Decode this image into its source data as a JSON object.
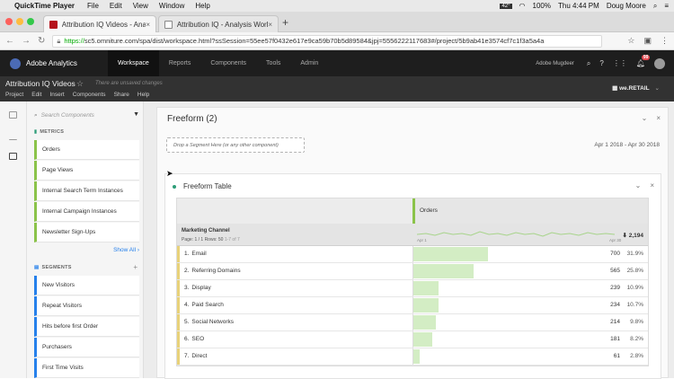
{
  "mac_menu": {
    "app": "QuickTime Player",
    "items": [
      "File",
      "Edit",
      "View",
      "Window",
      "Help"
    ],
    "battery": "100%",
    "clock": "Thu 4:44 PM",
    "user": "Doug Moore",
    "temp": "42°"
  },
  "browser": {
    "tabs": [
      {
        "label": "Attribution IQ Videos - Analysis",
        "active": true
      },
      {
        "label": "Attribution IQ - Analysis Works",
        "active": false
      }
    ],
    "url_prefix": "https://",
    "url": "sc5.omniture.com/spa/dist/workspace.html?ssSession=55ee57f0432e617e9ca59b70b5d89584&jpj=5556222117683#/project/5b9ab41e3574cf7c1f3a5a4a"
  },
  "analytics": {
    "brand": "Adobe Analytics",
    "nav": [
      "Workspace",
      "Reports",
      "Components",
      "Tools",
      "Admin"
    ],
    "active_nav": "Workspace",
    "company": "Adobe Mugdeer",
    "notification_count": "99"
  },
  "project": {
    "title": "Attribution IQ Videos",
    "unsaved": "There are unsaved changes",
    "menu": [
      "Project",
      "Edit",
      "Insert",
      "Components",
      "Share",
      "Help"
    ],
    "report_suite": "we.RETAIL"
  },
  "left_panel": {
    "search_placeholder": "Search Components",
    "metrics_header": "METRICS",
    "metrics": [
      "Orders",
      "Page Views",
      "Internal Search Term Instances",
      "Internal Campaign Instances",
      "Newsletter Sign-Ups"
    ],
    "show_all": "Show All",
    "segments_header": "SEGMENTS",
    "segments": [
      "New Visitors",
      "Repeat Visitors",
      "Hits before first Order",
      "Purchasers",
      "First Time Visits"
    ]
  },
  "freeform_panel": {
    "title": "Freeform (2)",
    "drop_zone": "Drop a Segment Here (or any other component)",
    "date_range": "Apr 1 2018 - Apr 30 2018"
  },
  "table": {
    "title": "Freeform Table",
    "metric": "Orders",
    "dimension": "Marketing Channel",
    "page_info": "Page: 1 / 1  Rows: 50",
    "page_count": "1-7 of 7",
    "spark_start": "Apr 1",
    "spark_end": "Apr 30",
    "total": "2,194",
    "rows": [
      {
        "n": "1.",
        "label": "Email",
        "value": "700",
        "pct": "31.9%",
        "share": 0.319
      },
      {
        "n": "2.",
        "label": "Referring Domains",
        "value": "565",
        "pct": "25.8%",
        "share": 0.258
      },
      {
        "n": "3.",
        "label": "Display",
        "value": "239",
        "pct": "10.9%",
        "share": 0.109
      },
      {
        "n": "4.",
        "label": "Paid Search",
        "value": "234",
        "pct": "10.7%",
        "share": 0.107
      },
      {
        "n": "5.",
        "label": "Social Networks",
        "value": "214",
        "pct": "9.8%",
        "share": 0.098
      },
      {
        "n": "6.",
        "label": "SEO",
        "value": "181",
        "pct": "8.2%",
        "share": 0.082
      },
      {
        "n": "7.",
        "label": "Direct",
        "value": "61",
        "pct": "2.8%",
        "share": 0.028
      }
    ]
  }
}
